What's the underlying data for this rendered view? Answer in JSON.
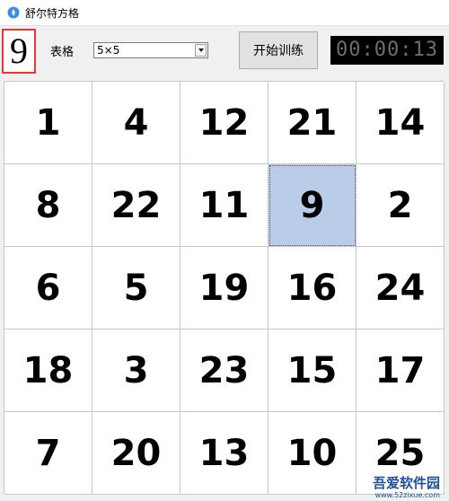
{
  "window": {
    "title": "舒尔特方格"
  },
  "toolbar": {
    "current_number": "9",
    "table_label": "表格",
    "grid_size_value": "5×5",
    "start_label": "开始训练",
    "timer": "00:00:13"
  },
  "grid": {
    "cells": [
      "1",
      "4",
      "12",
      "21",
      "14",
      "8",
      "22",
      "11",
      "9",
      "2",
      "6",
      "5",
      "19",
      "16",
      "24",
      "18",
      "3",
      "23",
      "15",
      "17",
      "7",
      "20",
      "13",
      "10",
      "25"
    ],
    "selected_index": 8,
    "selected_color": "#b9cde9"
  },
  "watermark": {
    "text": "吾爱软件园",
    "url": "www.52zixue.com"
  }
}
